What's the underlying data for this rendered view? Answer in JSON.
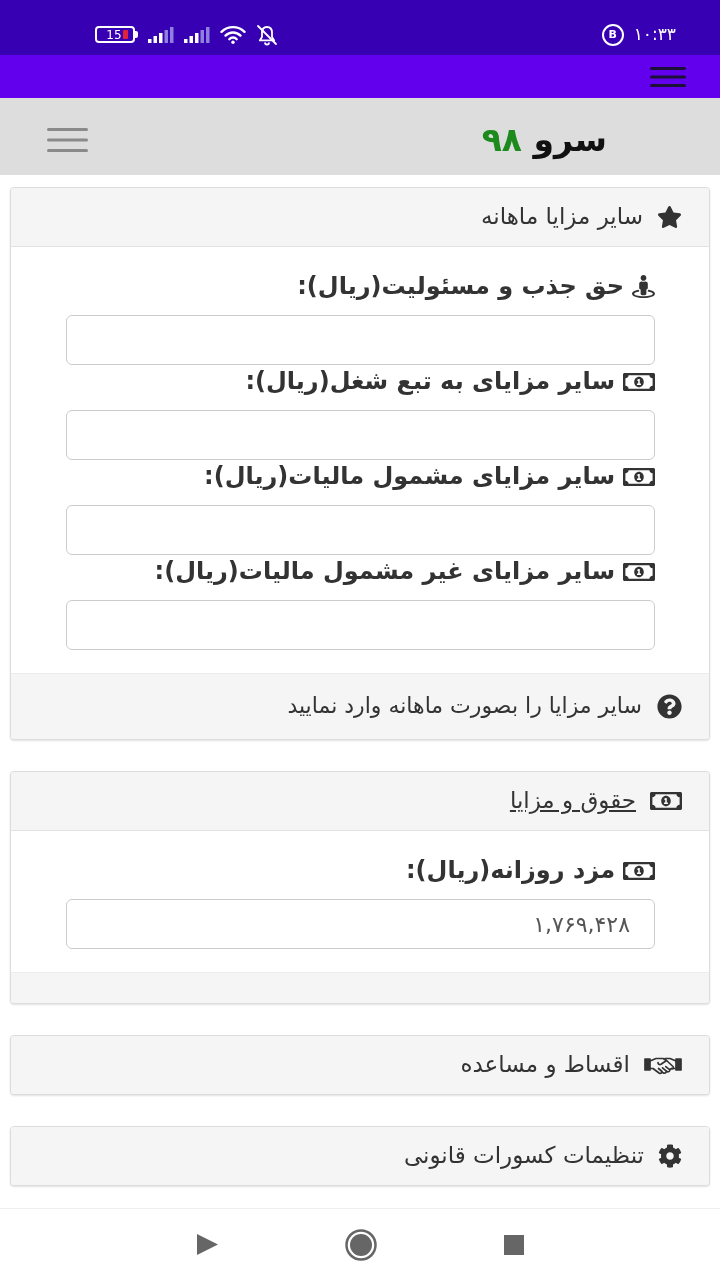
{
  "status_bar": {
    "battery": "15",
    "notification": "B",
    "time": "۱۰:۳۳"
  },
  "header": {
    "title": "سرو",
    "title_number": "۹۸"
  },
  "cards": [
    {
      "kind": "form",
      "title": "سایر مزایا ماهانه",
      "title_link": false,
      "fields": [
        {
          "label": "حق جذب و مسئولیت(ریال):"
        },
        {
          "label": "سایر مزایای به تبع شغل(ریال):"
        },
        {
          "label": "سایر مزایای مشمول مالیات(ریال):"
        },
        {
          "label": "سایر مزایای غیر مشمول مالیات(ریال):"
        }
      ],
      "note": "سایر مزایا را بصورت ماهانه وارد نمایید"
    },
    {
      "kind": "form",
      "title": "حقوق و مزایا",
      "title_link": true,
      "fields": [
        {
          "label": "مزد روزانه(ریال):",
          "value": "۱,۷۶۹,۴۲۸"
        }
      ]
    },
    {
      "kind": "collapsed",
      "title": "اقساط و مساعده",
      "title_link": false
    },
    {
      "kind": "collapsed",
      "title": "تنظیمات کسورات قانونی",
      "title_link": false
    }
  ]
}
